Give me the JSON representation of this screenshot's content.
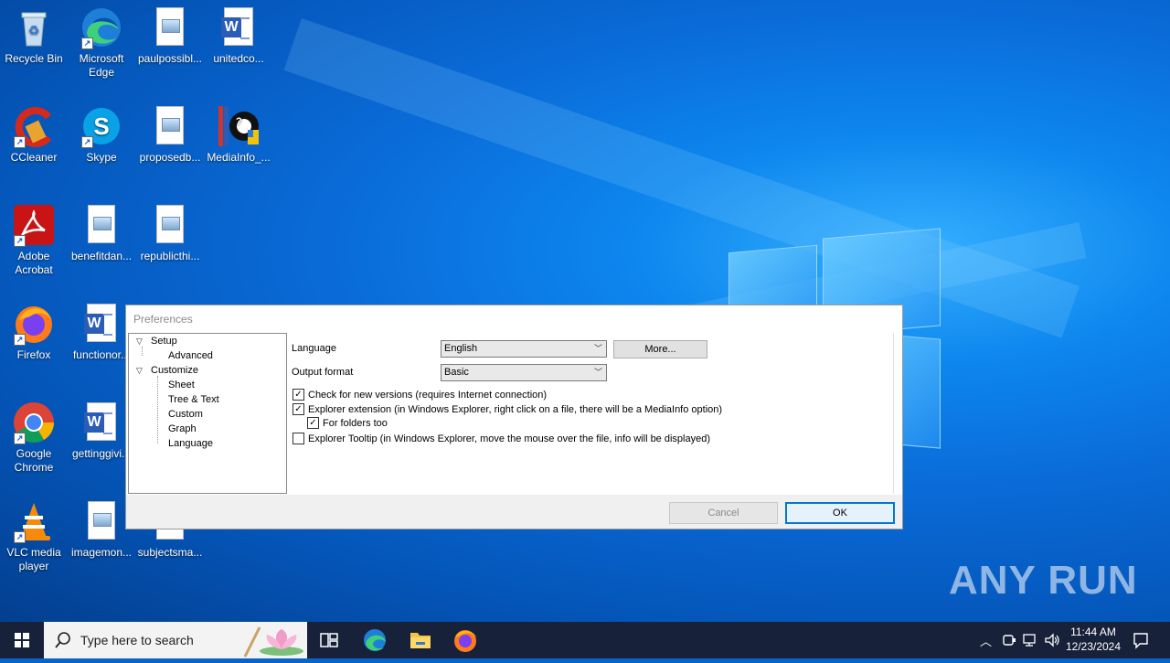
{
  "desktop": {
    "icons": [
      {
        "label": "Recycle Bin",
        "icon": "recycle-bin-icon"
      },
      {
        "label": "Microsoft Edge",
        "icon": "edge-icon"
      },
      {
        "label": "paulpossibl...",
        "icon": "image-file-icon"
      },
      {
        "label": "unitedco...",
        "icon": "word-doc-icon"
      },
      {
        "label": "CCleaner",
        "icon": "ccleaner-icon"
      },
      {
        "label": "Skype",
        "icon": "skype-icon"
      },
      {
        "label": "proposedb...",
        "icon": "image-file-icon"
      },
      {
        "label": "MediaInfo_...",
        "icon": "mediainfo-installer-icon"
      },
      {
        "label": "Adobe Acrobat",
        "icon": "acrobat-icon"
      },
      {
        "label": "benefitdan...",
        "icon": "image-file-icon"
      },
      {
        "label": "republicthi...",
        "icon": "image-file-icon"
      },
      {
        "label": "Firefox",
        "icon": "firefox-icon"
      },
      {
        "label": "functionor...",
        "icon": "word-doc-icon"
      },
      {
        "label": "Google Chrome",
        "icon": "chrome-icon"
      },
      {
        "label": "gettinggivi...",
        "icon": "word-doc-icon"
      },
      {
        "label": "VLC media player",
        "icon": "vlc-icon"
      },
      {
        "label": "imagemon...",
        "icon": "image-file-icon"
      },
      {
        "label": "subjectsma...",
        "icon": "image-file-icon"
      }
    ]
  },
  "prefs": {
    "title": "Preferences",
    "tree": {
      "setup": "Setup",
      "advanced": "Advanced",
      "customize": "Customize",
      "sheet": "Sheet",
      "tree_text": "Tree & Text",
      "custom": "Custom",
      "graph": "Graph",
      "language": "Language"
    },
    "language_label": "Language",
    "language_value": "English",
    "more_button": "More...",
    "output_label": "Output format",
    "output_value": "Basic",
    "check_versions": "Check for new versions (requires Internet connection)",
    "explorer_ext": "Explorer extension (in Windows Explorer, right click on a file, there will be a MediaInfo option)",
    "for_folders": "For folders too",
    "explorer_tooltip": "Explorer Tooltip (in Windows Explorer, move the mouse over the file, info will be displayed)",
    "checks": {
      "check_versions": true,
      "explorer_ext": true,
      "for_folders": true,
      "explorer_tooltip": false
    },
    "cancel": "Cancel",
    "ok": "OK"
  },
  "watermark": "ANY RUN",
  "taskbar": {
    "search_placeholder": "Type here to search",
    "time": "11:44 AM",
    "date": "12/23/2024"
  },
  "colors": {
    "accent": "#0078d7",
    "taskbar": "#17223a"
  }
}
